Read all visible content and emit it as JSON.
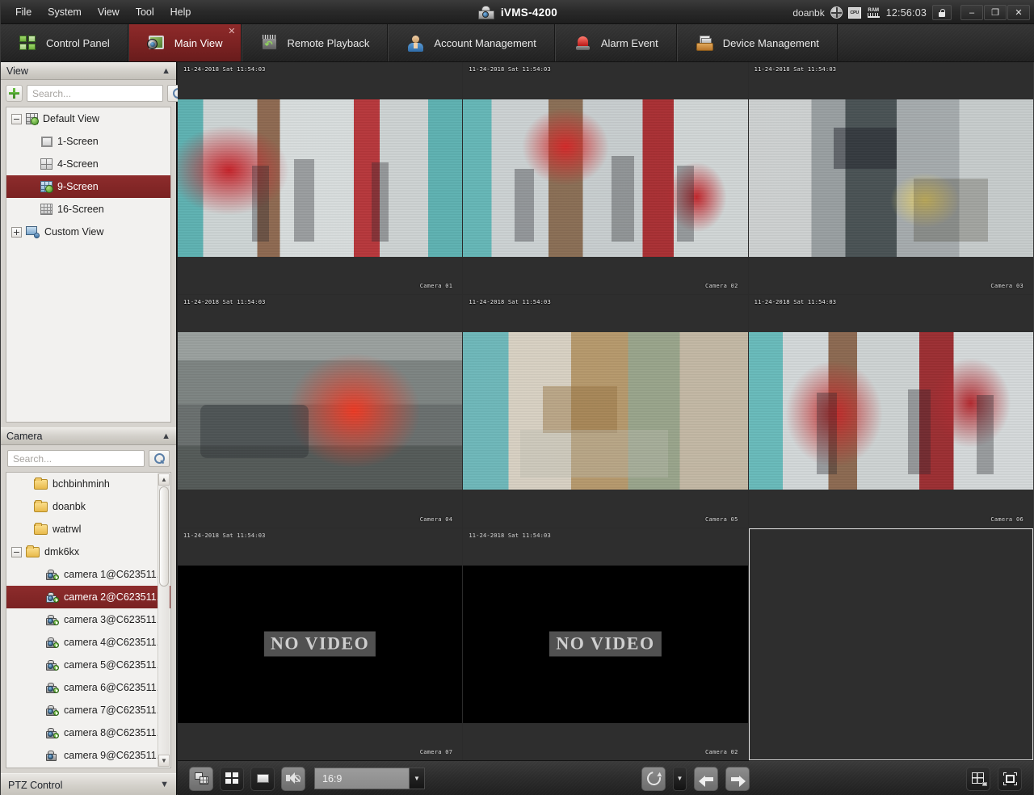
{
  "window": {
    "app_title": "iVMS-4200",
    "logo_icon": "camera-logo-icon",
    "user": "doanbk",
    "clock": "12:56:03",
    "status_icons": [
      "globe-icon",
      "cpu-icon",
      "ram-icon"
    ],
    "lock_icon": "lock-icon",
    "minimize_label": "–",
    "restore_label": "❐",
    "close_label": "✕"
  },
  "menubar": {
    "items": [
      {
        "label": "File"
      },
      {
        "label": "System"
      },
      {
        "label": "View"
      },
      {
        "label": "Tool"
      },
      {
        "label": "Help"
      }
    ]
  },
  "tabs": [
    {
      "label": "Control Panel",
      "icon": "control-panel-grid-icon",
      "active": false,
      "closable": false
    },
    {
      "label": "Main View",
      "icon": "main-view-monitor-icon",
      "active": true,
      "closable": true,
      "close_label": "✕"
    },
    {
      "label": "Remote Playback",
      "icon": "remote-playback-icon",
      "active": false,
      "closable": false
    },
    {
      "label": "Account Management",
      "icon": "account-user-icon",
      "active": false,
      "closable": false
    },
    {
      "label": "Alarm Event",
      "icon": "alarm-siren-icon",
      "active": false,
      "closable": false
    },
    {
      "label": "Device Management",
      "icon": "device-tray-icon",
      "active": false,
      "closable": false
    }
  ],
  "sidebar": {
    "view_panel": {
      "title": "View",
      "collapse_icon": "chevron-up-icon",
      "add_button_icon": "plus-icon",
      "search_placeholder": "Search...",
      "search_value": "",
      "search_button_icon": "search-icon",
      "tree": [
        {
          "label": "Default View",
          "icon": "grid-view-icon",
          "expander": "−",
          "level": 0,
          "selected": false
        },
        {
          "label": "1-Screen",
          "icon": "screen-1-icon",
          "expander": "",
          "level": 1,
          "selected": false
        },
        {
          "label": "4-Screen",
          "icon": "screen-4-icon",
          "expander": "",
          "level": 1,
          "selected": false
        },
        {
          "label": "9-Screen",
          "icon": "screen-9-icon",
          "expander": "",
          "level": 1,
          "selected": true
        },
        {
          "label": "16-Screen",
          "icon": "screen-16-icon",
          "expander": "",
          "level": 1,
          "selected": false
        },
        {
          "label": "Custom View",
          "icon": "custom-view-icon",
          "expander": "+",
          "level": 0,
          "selected": false
        }
      ]
    },
    "camera_panel": {
      "title": "Camera",
      "collapse_icon": "chevron-up-icon",
      "search_placeholder": "Search...",
      "search_value": "",
      "search_button_icon": "search-icon",
      "tree": [
        {
          "label": "bchbinhminh",
          "icon": "folder-icon",
          "expander": "",
          "level": 1,
          "selected": false
        },
        {
          "label": "doanbk",
          "icon": "folder-icon",
          "expander": "",
          "level": 1,
          "selected": false
        },
        {
          "label": "watrwl",
          "icon": "folder-icon",
          "expander": "",
          "level": 1,
          "selected": false
        },
        {
          "label": "dmk6kx",
          "icon": "folder-icon",
          "expander": "−",
          "level": 0,
          "selected": false
        },
        {
          "label": "camera 1@C623511...",
          "icon": "camera-online-icon",
          "expander": "",
          "level": 2,
          "selected": false
        },
        {
          "label": "camera 2@C623511...",
          "icon": "camera-online-icon",
          "expander": "",
          "level": 2,
          "selected": true
        },
        {
          "label": "camera 3@C623511...",
          "icon": "camera-online-icon",
          "expander": "",
          "level": 2,
          "selected": false
        },
        {
          "label": "camera 4@C623511...",
          "icon": "camera-online-icon",
          "expander": "",
          "level": 2,
          "selected": false
        },
        {
          "label": "camera 5@C623511...",
          "icon": "camera-online-icon",
          "expander": "",
          "level": 2,
          "selected": false
        },
        {
          "label": "camera 6@C623511...",
          "icon": "camera-online-icon",
          "expander": "",
          "level": 2,
          "selected": false
        },
        {
          "label": "camera 7@C623511...",
          "icon": "camera-online-icon",
          "expander": "",
          "level": 2,
          "selected": false
        },
        {
          "label": "camera 8@C623511...",
          "icon": "camera-online-icon",
          "expander": "",
          "level": 2,
          "selected": false
        },
        {
          "label": "camera 9@C623511...",
          "icon": "camera-offline-icon",
          "expander": "",
          "level": 2,
          "selected": false
        }
      ],
      "scrollbar": {
        "up_arrow": "▲",
        "down_arrow": "▼"
      }
    },
    "ptz_panel": {
      "title": "PTZ Control",
      "expand_icon": "chevron-down-icon"
    }
  },
  "main_view": {
    "layout": "9-screen",
    "cells": [
      {
        "index": 1,
        "state": "live",
        "timestamp": "11-24-2018 Sat 11:54:03",
        "camera_label": "Camera 01",
        "scene": "s-shop1"
      },
      {
        "index": 2,
        "state": "live",
        "timestamp": "11-24-2018 Sat 11:54:03",
        "camera_label": "Camera 02",
        "scene": "s-shop2"
      },
      {
        "index": 3,
        "state": "live",
        "timestamp": "11-24-2018 Sat 11:54:03",
        "camera_label": "Camera 03",
        "scene": "s-stairs"
      },
      {
        "index": 4,
        "state": "live",
        "timestamp": "11-24-2018 Sat 11:54:03",
        "camera_label": "Camera 04",
        "scene": "s-street"
      },
      {
        "index": 5,
        "state": "live",
        "timestamp": "11-24-2018 Sat 11:54:03",
        "camera_label": "Camera 05",
        "scene": "s-storage"
      },
      {
        "index": 6,
        "state": "live",
        "timestamp": "11-24-2018 Sat 11:54:03",
        "camera_label": "Camera 06",
        "scene": "s-shop3"
      },
      {
        "index": 7,
        "state": "no-video",
        "timestamp": "11-24-2018 Sat 11:54:03",
        "camera_label": "Camera 07",
        "message": "NO VIDEO"
      },
      {
        "index": 8,
        "state": "no-video",
        "timestamp": "11-24-2018 Sat 11:54:03",
        "camera_label": "Camera 02",
        "message": "NO VIDEO"
      },
      {
        "index": 9,
        "state": "empty",
        "selected": true
      }
    ]
  },
  "bottom_toolbar": {
    "capture_button_icon": "capture-icon",
    "layout_button_icon": "window-division-icon",
    "stop_all_button_icon": "stop-all-icon",
    "mute_button_icon": "mute-icon",
    "aspect_ratio_value": "16:9",
    "aspect_ratio_dropdown_icon": "chevron-down-icon",
    "refresh_button_icon": "refresh-icon",
    "refresh_dropdown_icon": "chevron-down-icon",
    "previous_button_icon": "arrow-left-icon",
    "next_button_icon": "arrow-right-icon",
    "screen_mode_button_icon": "screen-mode-icon",
    "fullscreen_button_icon": "fullscreen-icon"
  },
  "colors": {
    "accent_red": "#7b2222",
    "tab_active": "#8e2a2a",
    "panel_bg": "#d6d3ce",
    "tree_bg": "#f2f1ef",
    "video_bg": "#2e2e2e",
    "chrome_dark": "#2c2c2c"
  }
}
